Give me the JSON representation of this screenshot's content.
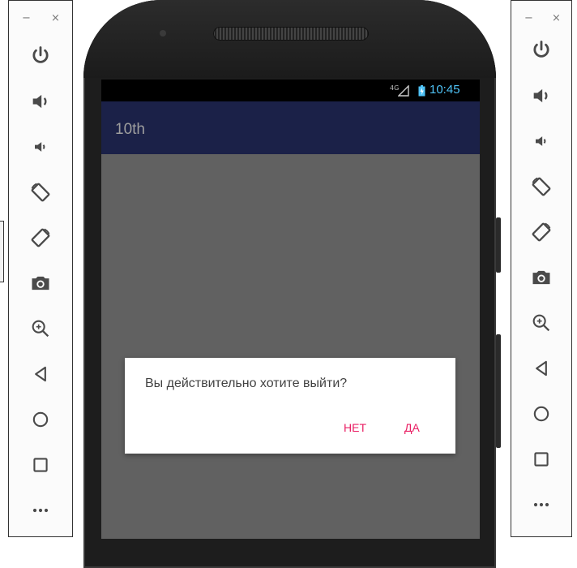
{
  "emulator": {
    "left_panel": {
      "window_controls": {
        "minimize": "−",
        "close": "×"
      },
      "tools": [
        "power-icon",
        "volume-up-icon",
        "volume-down-icon",
        "rotate-left-icon",
        "rotate-right-icon",
        "camera-icon",
        "zoom-icon",
        "back-icon",
        "home-icon",
        "overview-icon",
        "more-icon"
      ]
    },
    "right_panel": {
      "window_controls": {
        "minimize": "−",
        "close": "×"
      },
      "tools": [
        "power-icon",
        "volume-up-icon",
        "volume-down-icon",
        "rotate-left-icon",
        "rotate-right-icon",
        "camera-icon",
        "zoom-icon",
        "back-icon",
        "home-icon",
        "overview-icon",
        "more-icon"
      ]
    }
  },
  "device": {
    "status_bar": {
      "network": "4G",
      "time": "10:45"
    },
    "app_bar": {
      "title": "10th"
    },
    "dialog": {
      "message": "Вы действительно хотите выйти?",
      "negative_button": "НЕТ",
      "positive_button": "ДА"
    }
  },
  "colors": {
    "app_bar": "#1b2148",
    "screen_background": "#616161",
    "dialog_button": "#e91e63",
    "status_time": "#4fc3f7"
  }
}
